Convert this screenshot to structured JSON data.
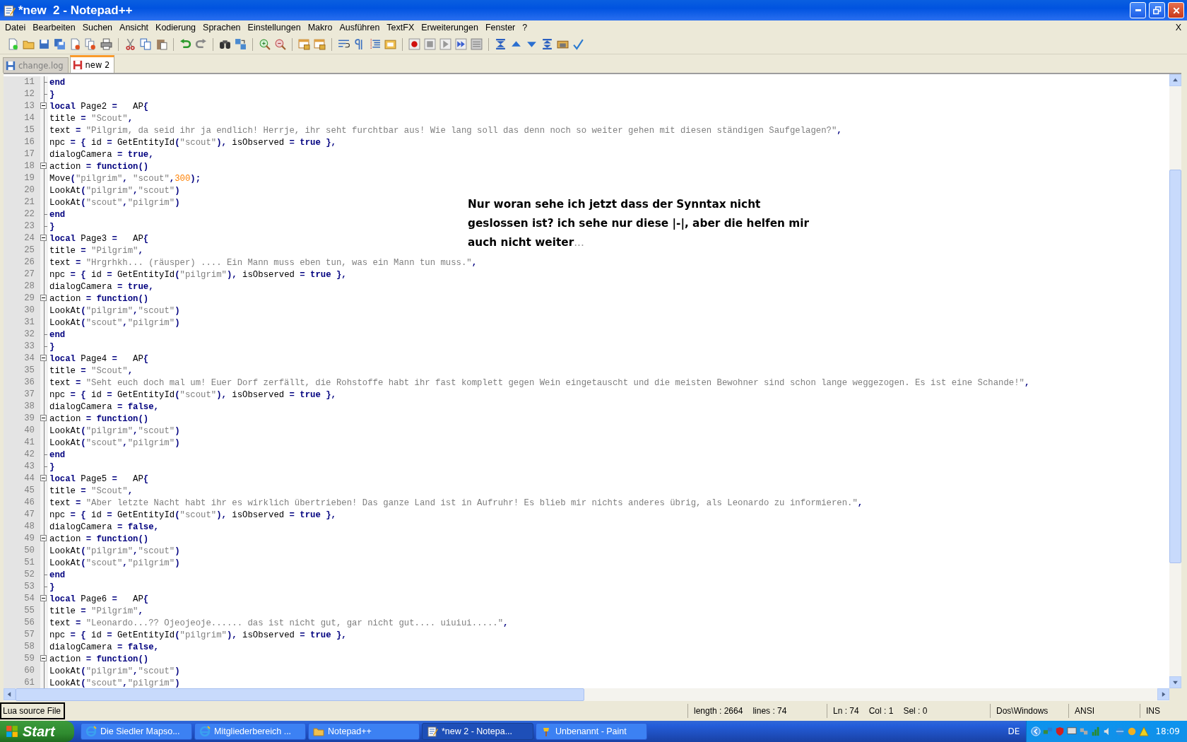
{
  "window": {
    "title": "*new  2 - Notepad++"
  },
  "menu": {
    "items": [
      "Datei",
      "Bearbeiten",
      "Suchen",
      "Ansicht",
      "Kodierung",
      "Sprachen",
      "Einstellungen",
      "Makro",
      "Ausführen",
      "TextFX",
      "Erweiterungen",
      "Fenster",
      "?"
    ],
    "close": "X"
  },
  "tabs": [
    {
      "label": "change.log",
      "selected": false,
      "modified": false
    },
    {
      "label": "new 2",
      "selected": true,
      "modified": true
    }
  ],
  "editor": {
    "lines": [
      {
        "number": "11",
        "fold_open": false,
        "fold_end": true,
        "tokens": [
          {
            "kind": "kw",
            "text": "end"
          }
        ]
      },
      {
        "number": "12",
        "fold_open": false,
        "fold_end": true,
        "tokens": [
          {
            "kind": "op",
            "text": "}"
          }
        ]
      },
      {
        "number": "13",
        "fold_open": true,
        "fold_end": false,
        "tokens": [
          {
            "kind": "kw",
            "text": "local"
          },
          {
            "kind": "id",
            "text": " Page2 "
          },
          {
            "kind": "op",
            "text": "="
          },
          {
            "kind": "id",
            "text": "   AP"
          },
          {
            "kind": "op",
            "text": "{"
          }
        ]
      },
      {
        "number": "14",
        "fold_open": false,
        "fold_end": false,
        "tokens": [
          {
            "kind": "id",
            "text": "title "
          },
          {
            "kind": "op",
            "text": "= "
          },
          {
            "kind": "str",
            "text": "\"Scout\""
          },
          {
            "kind": "op",
            "text": ","
          }
        ]
      },
      {
        "number": "15",
        "fold_open": false,
        "fold_end": false,
        "tokens": [
          {
            "kind": "id",
            "text": "text "
          },
          {
            "kind": "op",
            "text": "= "
          },
          {
            "kind": "str",
            "text": "\"Pilgrim, da seid ihr ja endlich! Herrje, ihr seht furchtbar aus! Wie lang soll das denn noch so weiter gehen mit diesen ständigen Saufgelagen?\""
          },
          {
            "kind": "op",
            "text": ","
          }
        ]
      },
      {
        "number": "16",
        "fold_open": false,
        "fold_end": false,
        "tokens": [
          {
            "kind": "id",
            "text": "npc "
          },
          {
            "kind": "op",
            "text": "= {"
          },
          {
            "kind": "id",
            "text": " id "
          },
          {
            "kind": "op",
            "text": "="
          },
          {
            "kind": "id",
            "text": " GetEntityId"
          },
          {
            "kind": "op",
            "text": "("
          },
          {
            "kind": "str",
            "text": "\"scout\""
          },
          {
            "kind": "op",
            "text": "),"
          },
          {
            "kind": "id",
            "text": " isObserved "
          },
          {
            "kind": "op",
            "text": "= "
          },
          {
            "kind": "kw",
            "text": "true"
          },
          {
            "kind": "op",
            "text": " },"
          }
        ]
      },
      {
        "number": "17",
        "fold_open": false,
        "fold_end": false,
        "tokens": [
          {
            "kind": "id",
            "text": "dialogCamera "
          },
          {
            "kind": "op",
            "text": "= "
          },
          {
            "kind": "kw",
            "text": "true"
          },
          {
            "kind": "op",
            "text": ","
          }
        ]
      },
      {
        "number": "18",
        "fold_open": true,
        "fold_end": false,
        "tokens": [
          {
            "kind": "id",
            "text": "action "
          },
          {
            "kind": "op",
            "text": "= "
          },
          {
            "kind": "kw",
            "text": "function"
          },
          {
            "kind": "op",
            "text": "()"
          }
        ]
      },
      {
        "number": "19",
        "fold_open": false,
        "fold_end": false,
        "tokens": [
          {
            "kind": "id",
            "text": "Move"
          },
          {
            "kind": "op",
            "text": "("
          },
          {
            "kind": "str",
            "text": "\"pilgrim\""
          },
          {
            "kind": "op",
            "text": ", "
          },
          {
            "kind": "str",
            "text": "\"scout\""
          },
          {
            "kind": "op",
            "text": ","
          },
          {
            "kind": "num",
            "text": "300"
          },
          {
            "kind": "op",
            "text": ");"
          }
        ]
      },
      {
        "number": "20",
        "fold_open": false,
        "fold_end": false,
        "tokens": [
          {
            "kind": "id",
            "text": "LookAt"
          },
          {
            "kind": "op",
            "text": "("
          },
          {
            "kind": "str",
            "text": "\"pilgrim\""
          },
          {
            "kind": "op",
            "text": ","
          },
          {
            "kind": "str",
            "text": "\"scout\""
          },
          {
            "kind": "op",
            "text": ")"
          }
        ]
      },
      {
        "number": "21",
        "fold_open": false,
        "fold_end": false,
        "tokens": [
          {
            "kind": "id",
            "text": "LookAt"
          },
          {
            "kind": "op",
            "text": "("
          },
          {
            "kind": "str",
            "text": "\"scout\""
          },
          {
            "kind": "op",
            "text": ","
          },
          {
            "kind": "str",
            "text": "\"pilgrim\""
          },
          {
            "kind": "op",
            "text": ")"
          }
        ]
      },
      {
        "number": "22",
        "fold_open": false,
        "fold_end": true,
        "tokens": [
          {
            "kind": "kw",
            "text": "end"
          }
        ]
      },
      {
        "number": "23",
        "fold_open": false,
        "fold_end": true,
        "tokens": [
          {
            "kind": "op",
            "text": "}"
          }
        ]
      },
      {
        "number": "24",
        "fold_open": true,
        "fold_end": false,
        "tokens": [
          {
            "kind": "kw",
            "text": "local"
          },
          {
            "kind": "id",
            "text": " Page3 "
          },
          {
            "kind": "op",
            "text": "="
          },
          {
            "kind": "id",
            "text": "   AP"
          },
          {
            "kind": "op",
            "text": "{"
          }
        ]
      },
      {
        "number": "25",
        "fold_open": false,
        "fold_end": false,
        "tokens": [
          {
            "kind": "id",
            "text": "title "
          },
          {
            "kind": "op",
            "text": "= "
          },
          {
            "kind": "str",
            "text": "\"Pilgrim\""
          },
          {
            "kind": "op",
            "text": ","
          }
        ]
      },
      {
        "number": "26",
        "fold_open": false,
        "fold_end": false,
        "tokens": [
          {
            "kind": "id",
            "text": "text "
          },
          {
            "kind": "op",
            "text": "= "
          },
          {
            "kind": "str",
            "text": "\"Hrgrhkh... (räusper) .... Ein Mann muss eben tun, was ein Mann tun muss.\""
          },
          {
            "kind": "op",
            "text": ","
          }
        ]
      },
      {
        "number": "27",
        "fold_open": false,
        "fold_end": false,
        "tokens": [
          {
            "kind": "id",
            "text": "npc "
          },
          {
            "kind": "op",
            "text": "= {"
          },
          {
            "kind": "id",
            "text": " id "
          },
          {
            "kind": "op",
            "text": "="
          },
          {
            "kind": "id",
            "text": " GetEntityId"
          },
          {
            "kind": "op",
            "text": "("
          },
          {
            "kind": "str",
            "text": "\"pilgrim\""
          },
          {
            "kind": "op",
            "text": "),"
          },
          {
            "kind": "id",
            "text": " isObserved "
          },
          {
            "kind": "op",
            "text": "= "
          },
          {
            "kind": "kw",
            "text": "true"
          },
          {
            "kind": "op",
            "text": " },"
          }
        ]
      },
      {
        "number": "28",
        "fold_open": false,
        "fold_end": false,
        "tokens": [
          {
            "kind": "id",
            "text": "dialogCamera "
          },
          {
            "kind": "op",
            "text": "= "
          },
          {
            "kind": "kw",
            "text": "true"
          },
          {
            "kind": "op",
            "text": ","
          }
        ]
      },
      {
        "number": "29",
        "fold_open": true,
        "fold_end": false,
        "tokens": [
          {
            "kind": "id",
            "text": "action "
          },
          {
            "kind": "op",
            "text": "= "
          },
          {
            "kind": "kw",
            "text": "function"
          },
          {
            "kind": "op",
            "text": "()"
          }
        ]
      },
      {
        "number": "30",
        "fold_open": false,
        "fold_end": false,
        "tokens": [
          {
            "kind": "id",
            "text": "LookAt"
          },
          {
            "kind": "op",
            "text": "("
          },
          {
            "kind": "str",
            "text": "\"pilgrim\""
          },
          {
            "kind": "op",
            "text": ","
          },
          {
            "kind": "str",
            "text": "\"scout\""
          },
          {
            "kind": "op",
            "text": ")"
          }
        ]
      },
      {
        "number": "31",
        "fold_open": false,
        "fold_end": false,
        "tokens": [
          {
            "kind": "id",
            "text": "LookAt"
          },
          {
            "kind": "op",
            "text": "("
          },
          {
            "kind": "str",
            "text": "\"scout\""
          },
          {
            "kind": "op",
            "text": ","
          },
          {
            "kind": "str",
            "text": "\"pilgrim\""
          },
          {
            "kind": "op",
            "text": ")"
          }
        ]
      },
      {
        "number": "32",
        "fold_open": false,
        "fold_end": true,
        "tokens": [
          {
            "kind": "kw",
            "text": "end"
          }
        ]
      },
      {
        "number": "33",
        "fold_open": false,
        "fold_end": true,
        "tokens": [
          {
            "kind": "op",
            "text": "}"
          }
        ]
      },
      {
        "number": "34",
        "fold_open": true,
        "fold_end": false,
        "tokens": [
          {
            "kind": "kw",
            "text": "local"
          },
          {
            "kind": "id",
            "text": " Page4 "
          },
          {
            "kind": "op",
            "text": "="
          },
          {
            "kind": "id",
            "text": "   AP"
          },
          {
            "kind": "op",
            "text": "{"
          }
        ]
      },
      {
        "number": "35",
        "fold_open": false,
        "fold_end": false,
        "tokens": [
          {
            "kind": "id",
            "text": "title "
          },
          {
            "kind": "op",
            "text": "= "
          },
          {
            "kind": "str",
            "text": "\"Scout\""
          },
          {
            "kind": "op",
            "text": ","
          }
        ]
      },
      {
        "number": "36",
        "fold_open": false,
        "fold_end": false,
        "tokens": [
          {
            "kind": "id",
            "text": "text "
          },
          {
            "kind": "op",
            "text": "= "
          },
          {
            "kind": "str",
            "text": "\"Seht euch doch mal um! Euer Dorf zerfällt, die Rohstoffe habt ihr fast komplett gegen Wein eingetauscht und die meisten Bewohner sind schon lange weggezogen. Es ist eine Schande!\""
          },
          {
            "kind": "op",
            "text": ","
          }
        ]
      },
      {
        "number": "37",
        "fold_open": false,
        "fold_end": false,
        "tokens": [
          {
            "kind": "id",
            "text": "npc "
          },
          {
            "kind": "op",
            "text": "= {"
          },
          {
            "kind": "id",
            "text": " id "
          },
          {
            "kind": "op",
            "text": "="
          },
          {
            "kind": "id",
            "text": " GetEntityId"
          },
          {
            "kind": "op",
            "text": "("
          },
          {
            "kind": "str",
            "text": "\"scout\""
          },
          {
            "kind": "op",
            "text": "),"
          },
          {
            "kind": "id",
            "text": " isObserved "
          },
          {
            "kind": "op",
            "text": "= "
          },
          {
            "kind": "kw",
            "text": "true"
          },
          {
            "kind": "op",
            "text": " },"
          }
        ]
      },
      {
        "number": "38",
        "fold_open": false,
        "fold_end": false,
        "tokens": [
          {
            "kind": "id",
            "text": "dialogCamera "
          },
          {
            "kind": "op",
            "text": "= "
          },
          {
            "kind": "kw",
            "text": "false"
          },
          {
            "kind": "op",
            "text": ","
          }
        ]
      },
      {
        "number": "39",
        "fold_open": true,
        "fold_end": false,
        "tokens": [
          {
            "kind": "id",
            "text": "action "
          },
          {
            "kind": "op",
            "text": "= "
          },
          {
            "kind": "kw",
            "text": "function"
          },
          {
            "kind": "op",
            "text": "()"
          }
        ]
      },
      {
        "number": "40",
        "fold_open": false,
        "fold_end": false,
        "tokens": [
          {
            "kind": "id",
            "text": "LookAt"
          },
          {
            "kind": "op",
            "text": "("
          },
          {
            "kind": "str",
            "text": "\"pilgrim\""
          },
          {
            "kind": "op",
            "text": ","
          },
          {
            "kind": "str",
            "text": "\"scout\""
          },
          {
            "kind": "op",
            "text": ")"
          }
        ]
      },
      {
        "number": "41",
        "fold_open": false,
        "fold_end": false,
        "tokens": [
          {
            "kind": "id",
            "text": "LookAt"
          },
          {
            "kind": "op",
            "text": "("
          },
          {
            "kind": "str",
            "text": "\"scout\""
          },
          {
            "kind": "op",
            "text": ","
          },
          {
            "kind": "str",
            "text": "\"pilgrim\""
          },
          {
            "kind": "op",
            "text": ")"
          }
        ]
      },
      {
        "number": "42",
        "fold_open": false,
        "fold_end": true,
        "tokens": [
          {
            "kind": "kw",
            "text": "end"
          }
        ]
      },
      {
        "number": "43",
        "fold_open": false,
        "fold_end": true,
        "tokens": [
          {
            "kind": "op",
            "text": "}"
          }
        ]
      },
      {
        "number": "44",
        "fold_open": true,
        "fold_end": false,
        "tokens": [
          {
            "kind": "kw",
            "text": "local"
          },
          {
            "kind": "id",
            "text": " Page5 "
          },
          {
            "kind": "op",
            "text": "="
          },
          {
            "kind": "id",
            "text": "   AP"
          },
          {
            "kind": "op",
            "text": "{"
          }
        ]
      },
      {
        "number": "45",
        "fold_open": false,
        "fold_end": false,
        "tokens": [
          {
            "kind": "id",
            "text": "title "
          },
          {
            "kind": "op",
            "text": "= "
          },
          {
            "kind": "str",
            "text": "\"Scout\""
          },
          {
            "kind": "op",
            "text": ","
          }
        ]
      },
      {
        "number": "46",
        "fold_open": false,
        "fold_end": false,
        "tokens": [
          {
            "kind": "id",
            "text": "text "
          },
          {
            "kind": "op",
            "text": "= "
          },
          {
            "kind": "str",
            "text": "\"Aber letzte Nacht habt ihr es wirklich übertrieben! Das ganze Land ist in Aufruhr! Es blieb mir nichts anderes übrig, als Leonardo zu informieren.\""
          },
          {
            "kind": "op",
            "text": ","
          }
        ]
      },
      {
        "number": "47",
        "fold_open": false,
        "fold_end": false,
        "tokens": [
          {
            "kind": "id",
            "text": "npc "
          },
          {
            "kind": "op",
            "text": "= {"
          },
          {
            "kind": "id",
            "text": " id "
          },
          {
            "kind": "op",
            "text": "="
          },
          {
            "kind": "id",
            "text": " GetEntityId"
          },
          {
            "kind": "op",
            "text": "("
          },
          {
            "kind": "str",
            "text": "\"scout\""
          },
          {
            "kind": "op",
            "text": "),"
          },
          {
            "kind": "id",
            "text": " isObserved "
          },
          {
            "kind": "op",
            "text": "= "
          },
          {
            "kind": "kw",
            "text": "true"
          },
          {
            "kind": "op",
            "text": " },"
          }
        ]
      },
      {
        "number": "48",
        "fold_open": false,
        "fold_end": false,
        "tokens": [
          {
            "kind": "id",
            "text": "dialogCamera "
          },
          {
            "kind": "op",
            "text": "= "
          },
          {
            "kind": "kw",
            "text": "false"
          },
          {
            "kind": "op",
            "text": ","
          }
        ]
      },
      {
        "number": "49",
        "fold_open": true,
        "fold_end": false,
        "tokens": [
          {
            "kind": "id",
            "text": "action "
          },
          {
            "kind": "op",
            "text": "= "
          },
          {
            "kind": "kw",
            "text": "function"
          },
          {
            "kind": "op",
            "text": "()"
          }
        ]
      },
      {
        "number": "50",
        "fold_open": false,
        "fold_end": false,
        "tokens": [
          {
            "kind": "id",
            "text": "LookAt"
          },
          {
            "kind": "op",
            "text": "("
          },
          {
            "kind": "str",
            "text": "\"pilgrim\""
          },
          {
            "kind": "op",
            "text": ","
          },
          {
            "kind": "str",
            "text": "\"scout\""
          },
          {
            "kind": "op",
            "text": ")"
          }
        ]
      },
      {
        "number": "51",
        "fold_open": false,
        "fold_end": false,
        "tokens": [
          {
            "kind": "id",
            "text": "LookAt"
          },
          {
            "kind": "op",
            "text": "("
          },
          {
            "kind": "str",
            "text": "\"scout\""
          },
          {
            "kind": "op",
            "text": ","
          },
          {
            "kind": "str",
            "text": "\"pilgrim\""
          },
          {
            "kind": "op",
            "text": ")"
          }
        ]
      },
      {
        "number": "52",
        "fold_open": false,
        "fold_end": true,
        "tokens": [
          {
            "kind": "kw",
            "text": "end"
          }
        ]
      },
      {
        "number": "53",
        "fold_open": false,
        "fold_end": true,
        "tokens": [
          {
            "kind": "op",
            "text": "}"
          }
        ]
      },
      {
        "number": "54",
        "fold_open": true,
        "fold_end": false,
        "tokens": [
          {
            "kind": "kw",
            "text": "local"
          },
          {
            "kind": "id",
            "text": " Page6 "
          },
          {
            "kind": "op",
            "text": "="
          },
          {
            "kind": "id",
            "text": "   AP"
          },
          {
            "kind": "op",
            "text": "{"
          }
        ]
      },
      {
        "number": "55",
        "fold_open": false,
        "fold_end": false,
        "tokens": [
          {
            "kind": "id",
            "text": "title "
          },
          {
            "kind": "op",
            "text": "= "
          },
          {
            "kind": "str",
            "text": "\"Pilgrim\""
          },
          {
            "kind": "op",
            "text": ","
          }
        ]
      },
      {
        "number": "56",
        "fold_open": false,
        "fold_end": false,
        "tokens": [
          {
            "kind": "id",
            "text": "text "
          },
          {
            "kind": "op",
            "text": "= "
          },
          {
            "kind": "str",
            "text": "\"Leonardo...?? Ojeojeoje...... das ist nicht gut, gar nicht gut.... uiuiui.....\""
          },
          {
            "kind": "op",
            "text": ","
          }
        ]
      },
      {
        "number": "57",
        "fold_open": false,
        "fold_end": false,
        "tokens": [
          {
            "kind": "id",
            "text": "npc "
          },
          {
            "kind": "op",
            "text": "= {"
          },
          {
            "kind": "id",
            "text": " id "
          },
          {
            "kind": "op",
            "text": "="
          },
          {
            "kind": "id",
            "text": " GetEntityId"
          },
          {
            "kind": "op",
            "text": "("
          },
          {
            "kind": "str",
            "text": "\"pilgrim\""
          },
          {
            "kind": "op",
            "text": "),"
          },
          {
            "kind": "id",
            "text": " isObserved "
          },
          {
            "kind": "op",
            "text": "= "
          },
          {
            "kind": "kw",
            "text": "true"
          },
          {
            "kind": "op",
            "text": " },"
          }
        ]
      },
      {
        "number": "58",
        "fold_open": false,
        "fold_end": false,
        "tokens": [
          {
            "kind": "id",
            "text": "dialogCamera "
          },
          {
            "kind": "op",
            "text": "= "
          },
          {
            "kind": "kw",
            "text": "false"
          },
          {
            "kind": "op",
            "text": ","
          }
        ]
      },
      {
        "number": "59",
        "fold_open": true,
        "fold_end": false,
        "tokens": [
          {
            "kind": "id",
            "text": "action "
          },
          {
            "kind": "op",
            "text": "= "
          },
          {
            "kind": "kw",
            "text": "function"
          },
          {
            "kind": "op",
            "text": "()"
          }
        ]
      },
      {
        "number": "60",
        "fold_open": false,
        "fold_end": false,
        "tokens": [
          {
            "kind": "id",
            "text": "LookAt"
          },
          {
            "kind": "op",
            "text": "("
          },
          {
            "kind": "str",
            "text": "\"pilgrim\""
          },
          {
            "kind": "op",
            "text": ","
          },
          {
            "kind": "str",
            "text": "\"scout\""
          },
          {
            "kind": "op",
            "text": ")"
          }
        ]
      },
      {
        "number": "61",
        "fold_open": false,
        "fold_end": false,
        "tokens": [
          {
            "kind": "id",
            "text": "LookAt"
          },
          {
            "kind": "op",
            "text": "("
          },
          {
            "kind": "str",
            "text": "\"scout\""
          },
          {
            "kind": "op",
            "text": ","
          },
          {
            "kind": "str",
            "text": "\"pilgrim\""
          },
          {
            "kind": "op",
            "text": ")"
          }
        ]
      }
    ]
  },
  "annotation": {
    "lines": [
      "Nur woran sehe ich jetzt dass der Synntax nicht",
      "geslossen ist? ich sehe nur diese |-|, aber die helfen mir",
      "auch nicht weiter"
    ],
    "trailing": "..."
  },
  "status_bar": {
    "file_type": "Lua source File",
    "length": "length : 2664",
    "lines": "lines : 74",
    "ln": "Ln : 74",
    "col": "Col : 1",
    "sel": "Sel : 0",
    "eol": "Dos\\Windows",
    "encoding": "ANSI",
    "mode": "INS"
  },
  "taskbar": {
    "start": "Start",
    "tasks": [
      {
        "label": "Die Siedler Mapso...",
        "kind": "browser",
        "selected": false
      },
      {
        "label": "Mitgliederbereich ...",
        "kind": "browser",
        "selected": false
      },
      {
        "label": "Notepad++",
        "kind": "folder",
        "selected": false
      },
      {
        "label": "*new  2 - Notepa...",
        "kind": "notepad",
        "selected": true
      },
      {
        "label": "Unbenannt - Paint",
        "kind": "paint",
        "selected": false
      }
    ],
    "language": "DE",
    "clock": "18:09"
  }
}
